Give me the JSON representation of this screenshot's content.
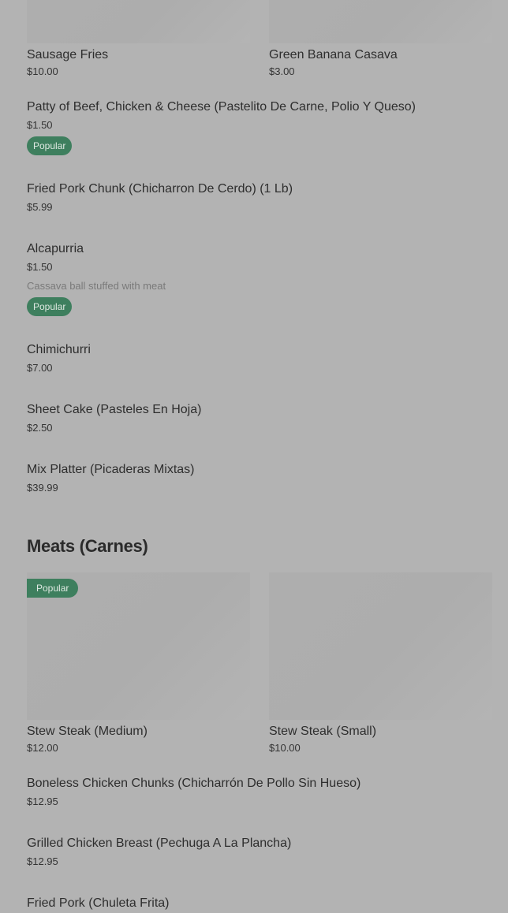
{
  "top_cards": [
    {
      "name": "Sausage Fries",
      "price": "$10.00"
    },
    {
      "name": "Green Banana Casava",
      "price": "$3.00"
    }
  ],
  "appetizers": [
    {
      "name": "Patty of Beef, Chicken & Cheese (Pastelito De Carne, Polio Y Queso)",
      "price": "$1.50",
      "badge": "Popular"
    },
    {
      "name": "Fried Pork Chunk (Chicharron De Cerdo) (1 Lb)",
      "price": "$5.99"
    },
    {
      "name": "Alcapurria",
      "price": "$1.50",
      "description": "Cassava ball stuffed with meat",
      "badge": "Popular"
    },
    {
      "name": "Chimichurri",
      "price": "$7.00"
    },
    {
      "name": "Sheet Cake (Pasteles En Hoja)",
      "price": "$2.50"
    },
    {
      "name": "Mix Platter (Picaderas Mixtas)",
      "price": "$39.99"
    }
  ],
  "meats_section": {
    "title": "Meats (Carnes)",
    "cards": [
      {
        "name": "Stew Steak (Medium)",
        "price": "$12.00",
        "badge": "Popular"
      },
      {
        "name": "Stew Steak (Small)",
        "price": "$10.00"
      }
    ],
    "items": [
      {
        "name": "Boneless Chicken Chunks (Chicharrón De Pollo Sin Hueso)",
        "price": "$12.95"
      },
      {
        "name": "Grilled Chicken Breast (Pechuga A La Plancha)",
        "price": "$12.95"
      },
      {
        "name": "Fried Pork (Chuleta Frita)"
      }
    ]
  },
  "colors": {
    "background": "#b3b3b3",
    "badge_bg": "#3e7f5e",
    "badge_text": "#dfe9e2"
  }
}
